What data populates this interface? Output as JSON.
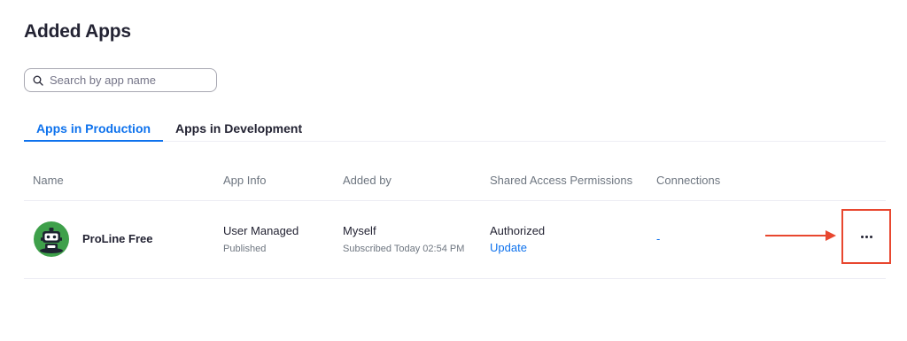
{
  "page": {
    "title": "Added Apps"
  },
  "search": {
    "placeholder": "Search by app name"
  },
  "tabs": [
    {
      "label": "Apps in Production",
      "active": true
    },
    {
      "label": "Apps in Development",
      "active": false
    }
  ],
  "table": {
    "headers": [
      "Name",
      "App Info",
      "Added by",
      "Shared Access Permissions",
      "Connections"
    ],
    "rows": [
      {
        "name": "ProLine Free",
        "icon": "robot-app-icon",
        "app_info": "User Managed",
        "app_info_sub": "Published",
        "added_by": "Myself",
        "added_by_sub": "Subscribed Today 02:54 PM",
        "permission": "Authorized",
        "permission_action": "Update",
        "connections": "-"
      }
    ]
  },
  "colors": {
    "accent": "#0e72ed",
    "annotation": "#e8472f",
    "app_icon_bg": "#3ea04a"
  }
}
